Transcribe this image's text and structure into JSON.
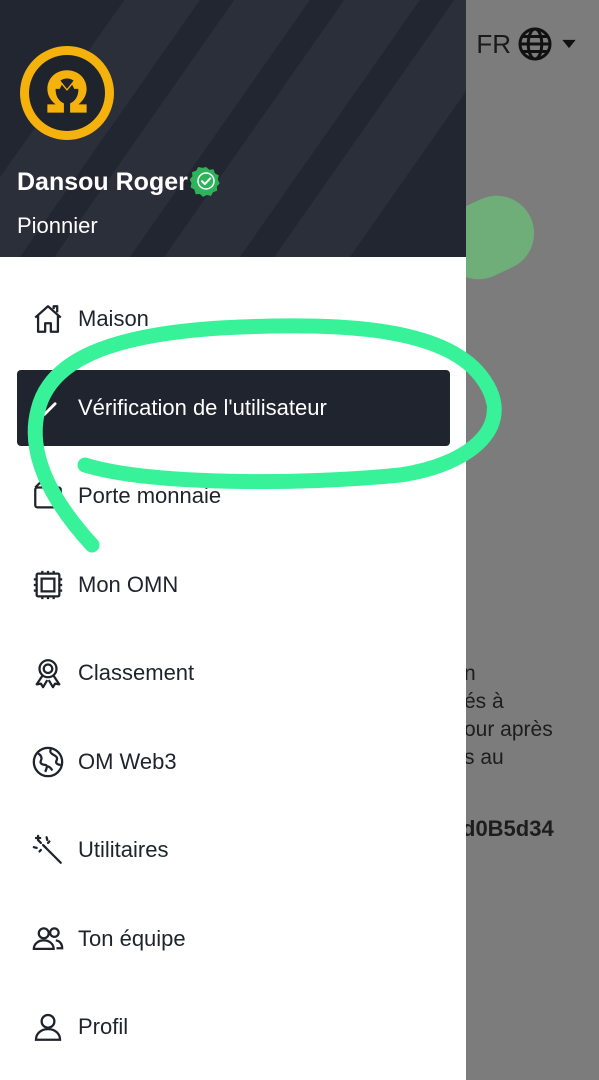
{
  "background_app": {
    "language_label": "FR",
    "partial_text_lines": "n\nés à\nour après\ns au",
    "partial_address": "d0B5d34"
  },
  "drawer": {
    "user": {
      "name": "Dansou Roger",
      "role": "Pionnier"
    },
    "menu": [
      {
        "label": "Maison",
        "icon": "home-icon"
      },
      {
        "label": "Vérification de l'utilisateur",
        "icon": "check-icon",
        "active": true
      },
      {
        "label": "Porte monnaie",
        "icon": "wallet-icon"
      },
      {
        "label": "Mon OMN",
        "icon": "chip-icon"
      },
      {
        "label": "Classement",
        "icon": "award-ribbon-icon"
      },
      {
        "label": "OM Web3",
        "icon": "globe-icon"
      },
      {
        "label": "Utilitaires",
        "icon": "magic-wand-icon"
      },
      {
        "label": "Ton équipe",
        "icon": "team-icon"
      },
      {
        "label": "Profil",
        "icon": "user-icon"
      }
    ]
  },
  "colors": {
    "drawer_header": "#222630",
    "active_item": "#20242f",
    "logo_gold": "#f6b20c",
    "verified_green": "#2fb35a",
    "annotation_green": "#38f29a"
  }
}
